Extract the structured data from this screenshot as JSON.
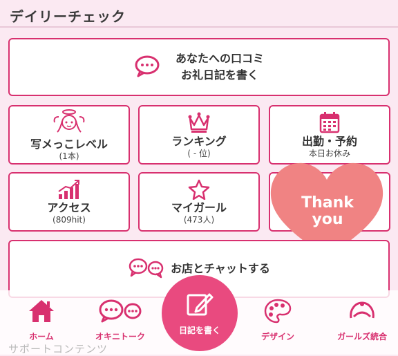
{
  "section": {
    "title": "デイリーチェック"
  },
  "kuchikomi": {
    "line1": "あなたへの口コミ",
    "line2": "お礼日記を書く"
  },
  "grid": [
    {
      "main": "写メっこレベル",
      "sub": "(1本)"
    },
    {
      "main": "ランキング",
      "sub": "( - 位)"
    },
    {
      "main": "出勤・予約",
      "sub": "本日お休み"
    },
    {
      "main": "アクセス",
      "sub": "(809hit)"
    },
    {
      "main": "マイガール",
      "sub": "(473人)"
    }
  ],
  "thankyou": {
    "line1": "Thank",
    "line2": "you"
  },
  "chat": {
    "label": "お店とチャットする"
  },
  "nav": {
    "home": "ホーム",
    "talk": "オキニトーク",
    "diary": "日記を書く",
    "design": "デザイン",
    "girls": "ガールズ統合"
  },
  "support": {
    "title": "サポートコンテンツ"
  },
  "colors": {
    "accent": "#d8306f",
    "heart": "#f08383",
    "background": "#fbe9f2"
  }
}
